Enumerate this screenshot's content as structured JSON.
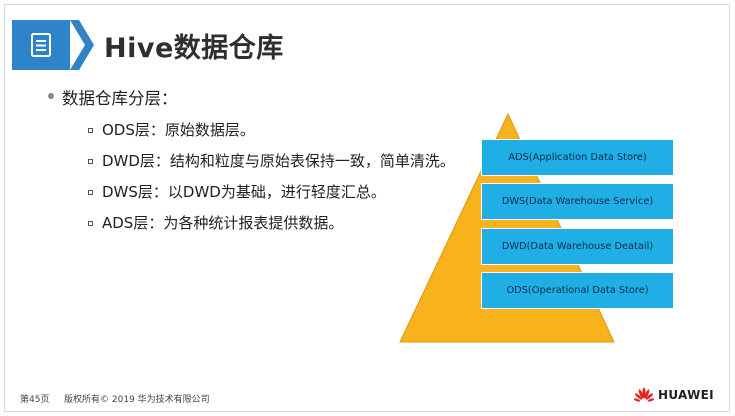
{
  "title": "Hive数据仓库",
  "main_bullet": "数据仓库分层：",
  "sub_items": [
    "ODS层：原始数据层。",
    "DWD层：结构和粒度与原始表保持一致，简单清洗。",
    "DWS层：以DWD为基础，进行轻度汇总。",
    "ADS层：为各种统计报表提供数据。"
  ],
  "layers": [
    "ADS(Application Data Store)",
    "DWS(Data Warehouse Service)",
    "DWD(Data  Warehouse Deatail)",
    "ODS(Operational Data Store)"
  ],
  "footer": {
    "page": "第45页",
    "copyright": "版权所有© 2019 华为技术有限公司",
    "brand": "HUAWEI"
  },
  "colors": {
    "title_banner": "#2f83c9",
    "pyramid_fill": "#f7b21c",
    "layer_fill": "#1faee6",
    "logo_red": "#e1251b"
  },
  "icons": {
    "title": "document-list-icon",
    "logo": "huawei-logo-icon"
  }
}
